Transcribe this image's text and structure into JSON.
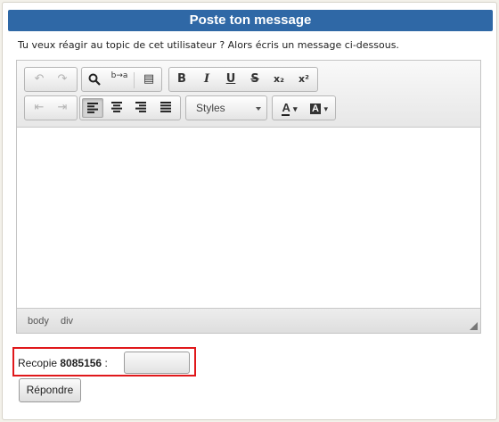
{
  "header": {
    "title": "Poste ton message"
  },
  "intro_text": "Tu veux réagir au topic de cet utilisateur ? Alors écris un message ci-dessous.",
  "toolbar": {
    "undo_icon": "↶",
    "redo_icon": "↷",
    "find_icon": "⌕",
    "replace_icon": "b→a",
    "select_all_icon": "▤",
    "bold": "B",
    "italic": "I",
    "underline": "U",
    "strikethrough": "S",
    "subscript": "x₂",
    "superscript": "x²",
    "outdent_icon": "⇤",
    "indent_icon": "⇥",
    "align_left_icon": "≡",
    "align_center_icon": "≡",
    "align_right_icon": "≡",
    "justify_icon": "≡",
    "styles_label": "Styles",
    "text_color": "A",
    "bg_color": "A",
    "dropdown_arrow": "▾"
  },
  "status_bar": {
    "path_body": "body",
    "path_div": "div"
  },
  "captcha": {
    "label": "Recopie",
    "code": "8085156",
    "colon": ":"
  },
  "reply_button": "Répondre",
  "colors": {
    "title_bar": "#2f68a6",
    "captcha_border": "#e0181b"
  }
}
